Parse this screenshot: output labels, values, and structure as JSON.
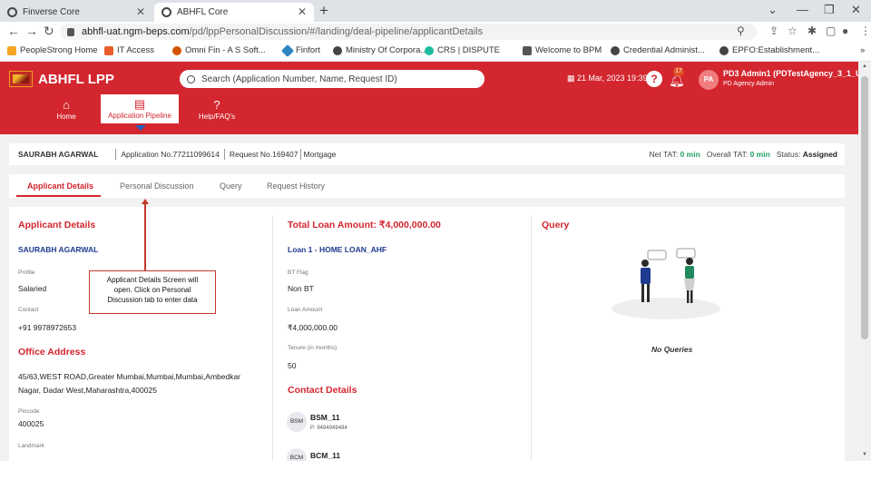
{
  "browser": {
    "tabs": [
      {
        "title": "Finverse Core",
        "active": false
      },
      {
        "title": "ABHFL Core",
        "active": true
      }
    ],
    "url_host": "abhfl-uat.ngm-beps.com",
    "url_path": "/pd/lppPersonalDiscussion/#/landing/deal-pipeline/applicantDetails",
    "bookmarks": [
      {
        "label": "PeopleStrong Home",
        "icon": "peoplestrong-icon",
        "color": "#f5a623"
      },
      {
        "label": "IT Access",
        "icon": "it-access-icon",
        "color": "#e85d2a"
      },
      {
        "label": "Omni Fin - A S Soft...",
        "icon": "omnifin-icon",
        "color": "#d35400"
      },
      {
        "label": "Finfort",
        "icon": "finfort-icon",
        "color": "#2e86c1"
      },
      {
        "label": "Ministry Of Corpora...",
        "icon": "globe-icon",
        "color": "#444444"
      },
      {
        "label": "CRS | DISPUTE",
        "icon": "crs-icon",
        "color": "#1abc9c"
      },
      {
        "label": "Welcome to BPM",
        "icon": "bpm-icon",
        "color": "#555555"
      },
      {
        "label": "Credential Administ...",
        "icon": "globe-icon",
        "color": "#444444"
      },
      {
        "label": "EPFO:Establishment...",
        "icon": "globe-icon",
        "color": "#444444"
      }
    ]
  },
  "app": {
    "brand": "ABHFL LPP",
    "search_placeholder": "Search (Application Number, Name, Request ID)",
    "datetime": "21 Mar, 2023 19:39",
    "help_glyph": "?",
    "notification_count": "17",
    "avatar_initials": "PA",
    "user_name": "PD3 Admin1 (PDTestAgency_3_1_User_",
    "user_role": "PD Agency Admin",
    "nav": [
      {
        "label": "Home",
        "icon": "home-icon"
      },
      {
        "label": "Application Pipeline",
        "icon": "pipeline-icon"
      },
      {
        "label": "Help/FAQ's",
        "icon": "help-faq-icon"
      }
    ]
  },
  "info_bar": {
    "applicant_name": "SAURABH AGARWAL",
    "application_no": "Application No.77211099614",
    "request_no": "Request No.169407",
    "product": "Mortgage",
    "net_tat_label": "Net TAT:",
    "net_tat_value": "0 min",
    "overall_tat_label": "Overall TAT:",
    "overall_tat_value": "0 min",
    "status_label": "Status:",
    "status_value": "Assigned"
  },
  "tabs": [
    "Applicant Details",
    "Personal Discussion",
    "Query",
    "Request History"
  ],
  "applicant": {
    "heading": "Applicant Details",
    "name": "SAURABH AGARWAL",
    "profile_label": "Profile",
    "profile_value": "Salaried",
    "contact_label": "Contact",
    "contact_value": "+91 9978972653",
    "office_heading": "Office Address",
    "office_line1": "45/63,WEST ROAD,Greater Mumbai,Mumbai,Mumbai,Ambedkar",
    "office_line2": "Nagar, Dadar West,Maharashtra,400025",
    "pincode_label": "Pincode",
    "pincode_value": "400025",
    "landmark_label": "Landmark"
  },
  "loan": {
    "heading": "Total Loan Amount: ₹4,000,000.00",
    "loan_title": "Loan 1 - HOME LOAN_AHF",
    "bt_label": "BT Flag",
    "bt_value": "Non BT",
    "amount_label": "Loan Amount",
    "amount_value": "₹4,000,000.00",
    "tenure_label": "Tenure (in months)",
    "tenure_value": "50",
    "contact_heading": "Contact Details",
    "contacts": [
      {
        "tag": "BSM",
        "name": "BSM_11",
        "phone": "P: 9494949494"
      },
      {
        "tag": "BCM",
        "name": "BCM_11"
      }
    ]
  },
  "query": {
    "heading": "Query",
    "empty_text": "No Queries"
  },
  "annotation": {
    "line1": "Applicant Details Screen will",
    "line2": "open. Click on Personal",
    "line3": "Discussion tab to enter data"
  },
  "colors": {
    "brand_red": "#d3262e",
    "link_blue": "#1f3b8f",
    "tat_green": "#21a366"
  }
}
